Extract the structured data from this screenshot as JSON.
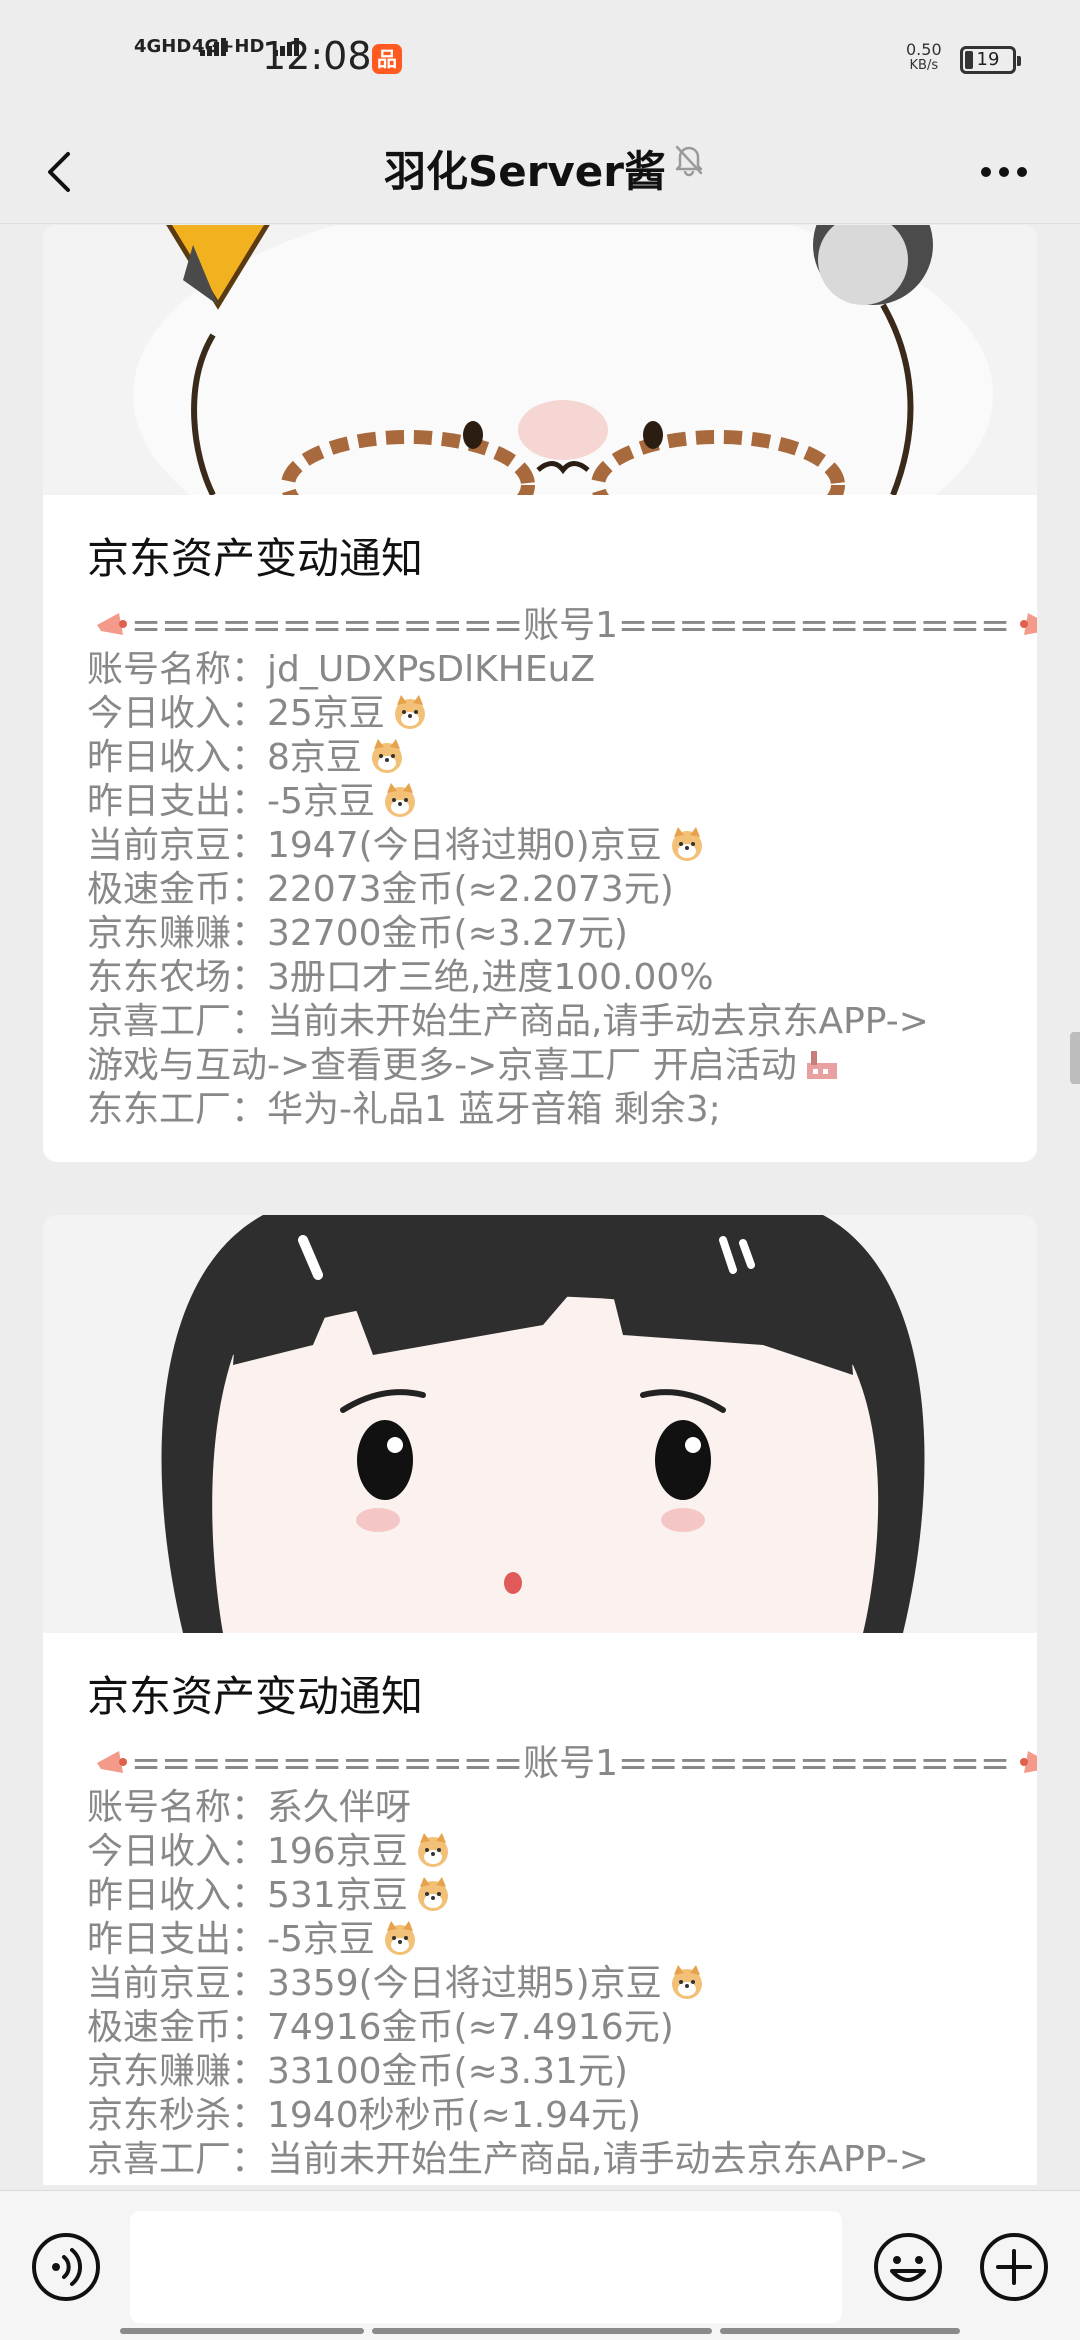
{
  "status": {
    "sig1": "4GHD",
    "sig2": "4G+HD",
    "time": "12:08",
    "app_badge": "品",
    "net_speed": "0.50",
    "net_unit": "KB/s",
    "battery": "19"
  },
  "nav": {
    "title": "羽化Server酱"
  },
  "cards": [
    {
      "title": "京东资产变动通知",
      "header": "=============账号1=============",
      "lines": [
        "账号名称：jd_UDXPsDlKHEuZ",
        "今日收入：25京豆",
        "昨日收入：8京豆",
        "昨日支出：-5京豆",
        "当前京豆：1947(今日将过期0)京豆",
        "极速金币：22073金币(≈2.2073元)",
        "京东赚赚：32700金币(≈3.27元)",
        "东东农场：3册口才三绝,进度100.00%",
        "京喜工厂：当前未开始生产商品,请手动去京东APP->",
        "游戏与互动->查看更多->京喜工厂 开启活动",
        "东东工厂：华为-礼品1 蓝牙音箱 剩余3;"
      ]
    },
    {
      "title": "京东资产变动通知",
      "header": "=============账号1=============",
      "lines": [
        "账号名称：系久伴呀",
        "今日收入：196京豆",
        "昨日收入：531京豆",
        "昨日支出：-5京豆",
        "当前京豆：3359(今日将过期5)京豆",
        "极速金币：74916金币(≈7.4916元)",
        "京东赚赚：33100金币(≈3.31元)",
        "京东秒杀：1940秒秒币(≈1.94元)",
        "京喜工厂：当前未开始生产商品,请手动去京东APP->"
      ]
    }
  ],
  "icons": {
    "back": "chevron-left-icon",
    "mute": "bell-muted-icon",
    "more": "more-dots-icon",
    "voice": "voice-icon",
    "emoji": "emoji-face-icon",
    "plus": "plus-icon",
    "inline": "dog-face-emoji",
    "megaphone": "megaphone-emoji",
    "factory": "factory-emoji"
  },
  "colors": {
    "background": "#ededed",
    "card": "#ffffff",
    "text_gray": "#888888",
    "title": "#111111"
  }
}
